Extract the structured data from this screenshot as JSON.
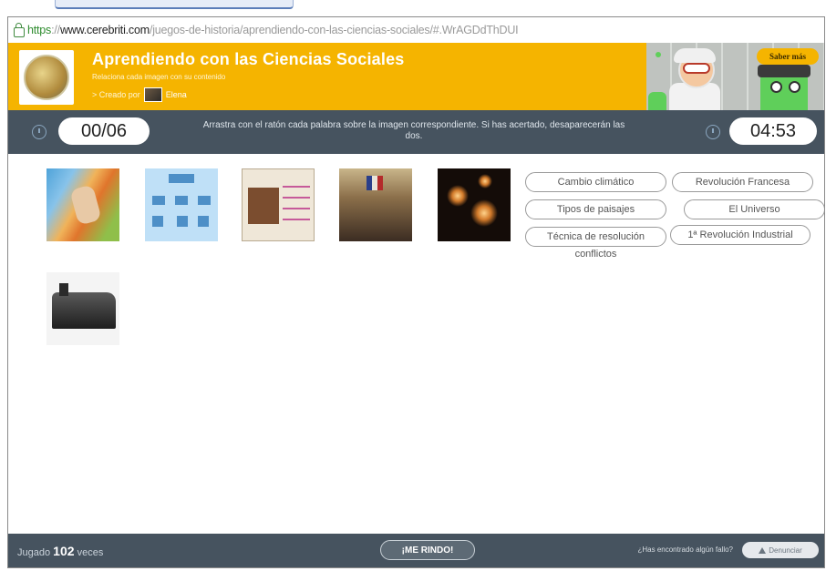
{
  "browser": {
    "url_scheme": "https",
    "url_sep": "://",
    "url_host": "www.cerebriti.com",
    "url_path": "/juegos-de-historia/aprendiendo-con-las-ciencias-sociales/#.WrAGDdThDUI"
  },
  "header": {
    "title": "Aprendiendo con las Ciencias Sociales",
    "subtitle": "Relaciona cada imagen con su contenido",
    "created_by_label": "> Creado por",
    "author": "Elena",
    "saber_mas": "Saber más"
  },
  "game": {
    "score": "00/06",
    "timer": "04:53",
    "instructions": "Arrastra con el ratón cada palabra sobre la imagen correspondiente. Si has acertado, desaparecerán las dos."
  },
  "images": [
    {
      "name": "cambio-climatico-image"
    },
    {
      "name": "tipos-paisajes-diagram-image"
    },
    {
      "name": "resolucion-conflictos-document-image"
    },
    {
      "name": "revolucion-francesa-painting-image"
    },
    {
      "name": "universo-image"
    },
    {
      "name": "locomotive-image"
    }
  ],
  "words": {
    "w1": "Cambio climático",
    "w2": "Revolución Francesa",
    "w3": "Tipos de paisajes",
    "w4": "El Universo",
    "w5_line1": "Técnica de resolución",
    "w5_line2": "conflictos",
    "w6": "1ª Revolución Industrial"
  },
  "footer": {
    "played_label": "Jugado",
    "played_count": "102",
    "played_suffix": "veces",
    "give_up": "¡ME RINDO!",
    "fault_question": "¿Has encontrado algún fallo?",
    "report": "Denunciar"
  },
  "colors": {
    "header_bg": "#f5b400",
    "toolbar_bg": "#46535f",
    "accent_green": "#5fcf5a"
  }
}
